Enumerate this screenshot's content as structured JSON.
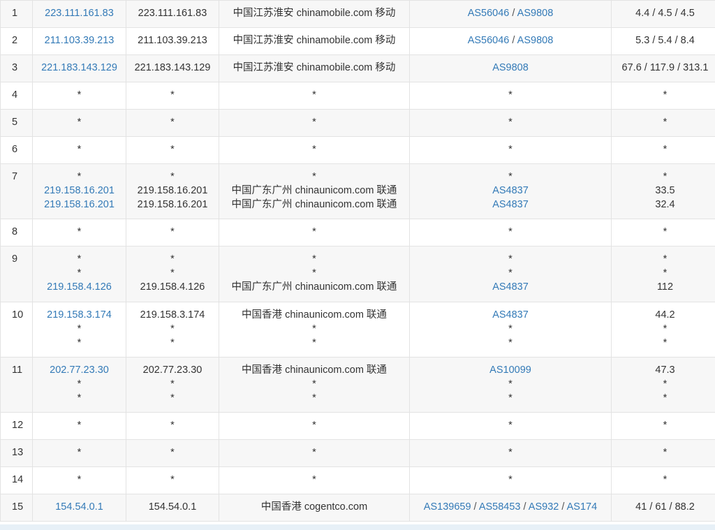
{
  "hops": [
    {
      "hop": "1",
      "lines": [
        {
          "ip": "223.111.161.83",
          "host": "223.111.161.83",
          "geo": "中国江苏淮安 chinamobile.com 移动",
          "asn": [
            "AS56046",
            "AS9808"
          ],
          "time": "4.4 / 4.5 / 4.5"
        }
      ]
    },
    {
      "hop": "2",
      "lines": [
        {
          "ip": "211.103.39.213",
          "host": "211.103.39.213",
          "geo": "中国江苏淮安 chinamobile.com 移动",
          "asn": [
            "AS56046",
            "AS9808"
          ],
          "time": "5.3 / 5.4 / 8.4"
        }
      ]
    },
    {
      "hop": "3",
      "lines": [
        {
          "ip": "221.183.143.129",
          "host": "221.183.143.129",
          "geo": "中国江苏淮安 chinamobile.com 移动",
          "asn": [
            "AS9808"
          ],
          "time": "67.6 / 117.9 / 313.1"
        }
      ]
    },
    {
      "hop": "4",
      "lines": [
        {
          "ip": "*",
          "host": "*",
          "geo": "*",
          "asn": [
            "*"
          ],
          "time": "*"
        }
      ]
    },
    {
      "hop": "5",
      "lines": [
        {
          "ip": "*",
          "host": "*",
          "geo": "*",
          "asn": [
            "*"
          ],
          "time": "*"
        }
      ]
    },
    {
      "hop": "6",
      "lines": [
        {
          "ip": "*",
          "host": "*",
          "geo": "*",
          "asn": [
            "*"
          ],
          "time": "*"
        }
      ]
    },
    {
      "hop": "7",
      "lines": [
        {
          "ip": "*",
          "host": "*",
          "geo": "*",
          "asn": [
            "*"
          ],
          "time": "*"
        },
        {
          "ip": "219.158.16.201",
          "host": "219.158.16.201",
          "geo": "中国广东广州 chinaunicom.com 联通",
          "asn": [
            "AS4837"
          ],
          "time": "33.5"
        },
        {
          "ip": "219.158.16.201",
          "host": "219.158.16.201",
          "geo": "中国广东广州 chinaunicom.com 联通",
          "asn": [
            "AS4837"
          ],
          "time": "32.4"
        }
      ]
    },
    {
      "hop": "8",
      "lines": [
        {
          "ip": "*",
          "host": "*",
          "geo": "*",
          "asn": [
            "*"
          ],
          "time": "*"
        }
      ]
    },
    {
      "hop": "9",
      "lines": [
        {
          "ip": "*",
          "host": "*",
          "geo": "*",
          "asn": [
            "*"
          ],
          "time": "*"
        },
        {
          "ip": "*",
          "host": "*",
          "geo": "*",
          "asn": [
            "*"
          ],
          "time": "*"
        },
        {
          "ip": "219.158.4.126",
          "host": "219.158.4.126",
          "geo": "中国广东广州 chinaunicom.com 联通",
          "asn": [
            "AS4837"
          ],
          "time": "112"
        }
      ]
    },
    {
      "hop": "10",
      "lines": [
        {
          "ip": "219.158.3.174",
          "host": "219.158.3.174",
          "geo": "中国香港 chinaunicom.com 联通",
          "asn": [
            "AS4837"
          ],
          "time": "44.2"
        },
        {
          "ip": "*",
          "host": "*",
          "geo": "*",
          "asn": [
            "*"
          ],
          "time": "*"
        },
        {
          "ip": "*",
          "host": "*",
          "geo": "*",
          "asn": [
            "*"
          ],
          "time": "*"
        }
      ]
    },
    {
      "hop": "11",
      "lines": [
        {
          "ip": "202.77.23.30",
          "host": "202.77.23.30",
          "geo": "中国香港 chinaunicom.com 联通",
          "asn": [
            "AS10099"
          ],
          "time": "47.3"
        },
        {
          "ip": "*",
          "host": "*",
          "geo": "*",
          "asn": [
            "*"
          ],
          "time": "*"
        },
        {
          "ip": "*",
          "host": "*",
          "geo": "*",
          "asn": [
            "*"
          ],
          "time": "*"
        }
      ]
    },
    {
      "hop": "12",
      "lines": [
        {
          "ip": "*",
          "host": "*",
          "geo": "*",
          "asn": [
            "*"
          ],
          "time": "*"
        }
      ]
    },
    {
      "hop": "13",
      "lines": [
        {
          "ip": "*",
          "host": "*",
          "geo": "*",
          "asn": [
            "*"
          ],
          "time": "*"
        }
      ]
    },
    {
      "hop": "14",
      "lines": [
        {
          "ip": "*",
          "host": "*",
          "geo": "*",
          "asn": [
            "*"
          ],
          "time": "*"
        }
      ]
    },
    {
      "hop": "15",
      "lines": [
        {
          "ip": "154.54.0.1",
          "host": "154.54.0.1",
          "geo": "中国香港 cogentco.com",
          "asn": [
            "AS139659",
            "AS58453",
            "AS932",
            "AS174"
          ],
          "time": "41 / 61 / 88.2",
          "blurred": true
        }
      ]
    }
  ],
  "colors": {
    "link": "#337ab7",
    "text": "#333333",
    "row_alt": "#f7f7f7",
    "border": "#e3e3e3"
  }
}
